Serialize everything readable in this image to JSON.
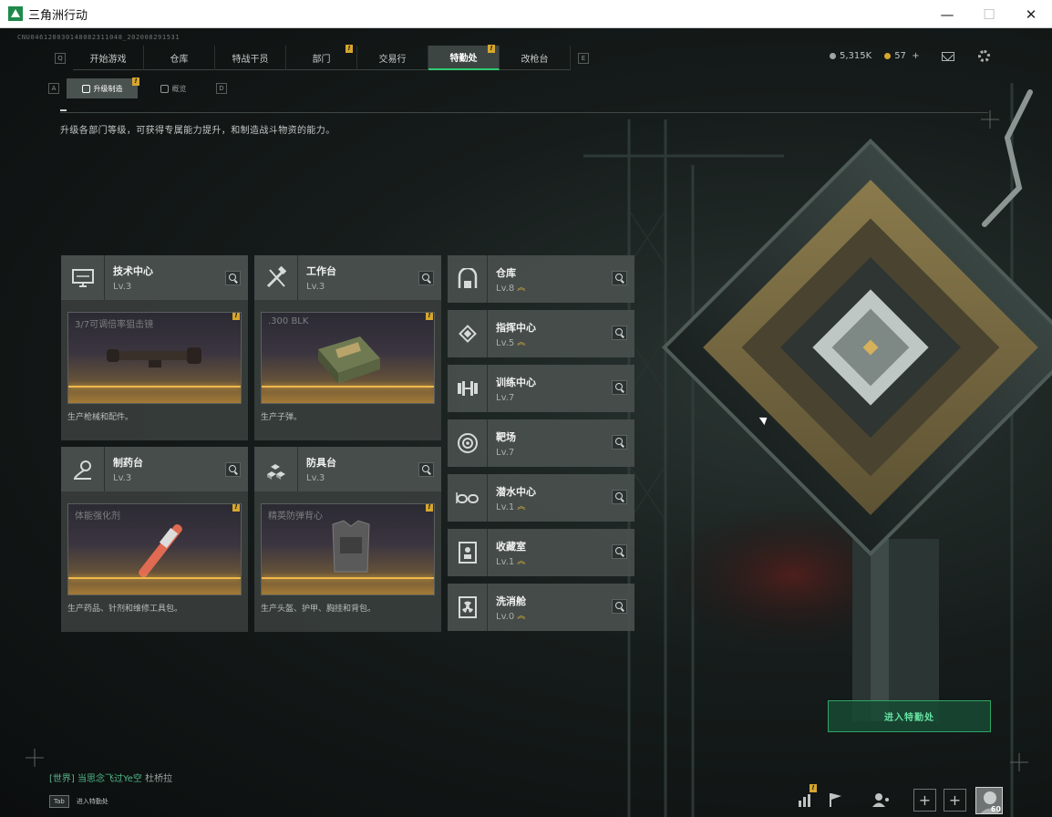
{
  "window": {
    "title": "三角洲行动",
    "min": "—",
    "max": "☐",
    "close": "✕"
  },
  "build_id": "CNU046120030148082311048_202008291531",
  "topnav": {
    "key_left": "Q",
    "key_right": "E",
    "tabs": [
      {
        "label": "开始游戏",
        "badge": ""
      },
      {
        "label": "仓库",
        "badge": ""
      },
      {
        "label": "特战干员",
        "badge": ""
      },
      {
        "label": "部门",
        "badge": "!"
      },
      {
        "label": "交易行",
        "badge": ""
      },
      {
        "label": "特勤处",
        "badge": "!",
        "active": true
      },
      {
        "label": "改枪台",
        "badge": ""
      }
    ]
  },
  "resources": {
    "currency1": "5,315K",
    "currency2": "57",
    "plus": "+"
  },
  "subnav": {
    "key_left": "A",
    "key_right": "D",
    "tabs": [
      {
        "label": "升级制造",
        "badge": "!",
        "active": true
      },
      {
        "label": "概览",
        "badge": ""
      }
    ]
  },
  "description": "升级各部门等级，可获得专属能力提升，和制造战斗物资的能力。",
  "production_cards": [
    {
      "name": "技术中心",
      "level": "Lv.3",
      "product": "3/7可调倍率狙击镜",
      "badge": "!",
      "footer": "生产枪械和配件。",
      "icon": "monitor-icon"
    },
    {
      "name": "工作台",
      "level": "Lv.3",
      "product": ".300 BLK",
      "badge": "!",
      "footer": "生产子弹。",
      "icon": "tools-icon"
    },
    {
      "name": "制药台",
      "level": "Lv.3",
      "product": "体能强化剂",
      "badge": "!",
      "footer": "生产药品、针剂和维修工具包。",
      "icon": "microscope-icon"
    },
    {
      "name": "防具台",
      "level": "Lv.3",
      "product": "精英防弹背心",
      "badge": "!",
      "footer": "生产头盔、护甲、胸挂和背包。",
      "icon": "cubes-icon"
    }
  ],
  "facility_cards": [
    {
      "name": "仓库",
      "level": "Lv.8",
      "upgrade": true,
      "icon": "warehouse-icon"
    },
    {
      "name": "指挥中心",
      "level": "Lv.5",
      "upgrade": true,
      "icon": "chip-icon"
    },
    {
      "name": "训练中心",
      "level": "Lv.7",
      "upgrade": false,
      "icon": "dumbbell-icon"
    },
    {
      "name": "靶场",
      "level": "Lv.7",
      "upgrade": false,
      "icon": "target-icon"
    },
    {
      "name": "潜水中心",
      "level": "Lv.1",
      "upgrade": true,
      "icon": "goggles-icon"
    },
    {
      "name": "收藏室",
      "level": "Lv.1",
      "upgrade": true,
      "icon": "vault-icon"
    },
    {
      "name": "洗消舱",
      "level": "Lv.0",
      "upgrade": true,
      "icon": "radiation-icon"
    }
  ],
  "enter_button": "进入特勤处",
  "chat": {
    "channel": "[世界]",
    "user": "当思念飞过Ye空",
    "message": "杜桥拉"
  },
  "tab_hint": {
    "key": "Tab",
    "label": "进入特勤处"
  },
  "avatar_level": "60",
  "colors": {
    "accent": "#2ecc71",
    "badge": "#d6a62e",
    "upgrade": "#e2b43a"
  }
}
